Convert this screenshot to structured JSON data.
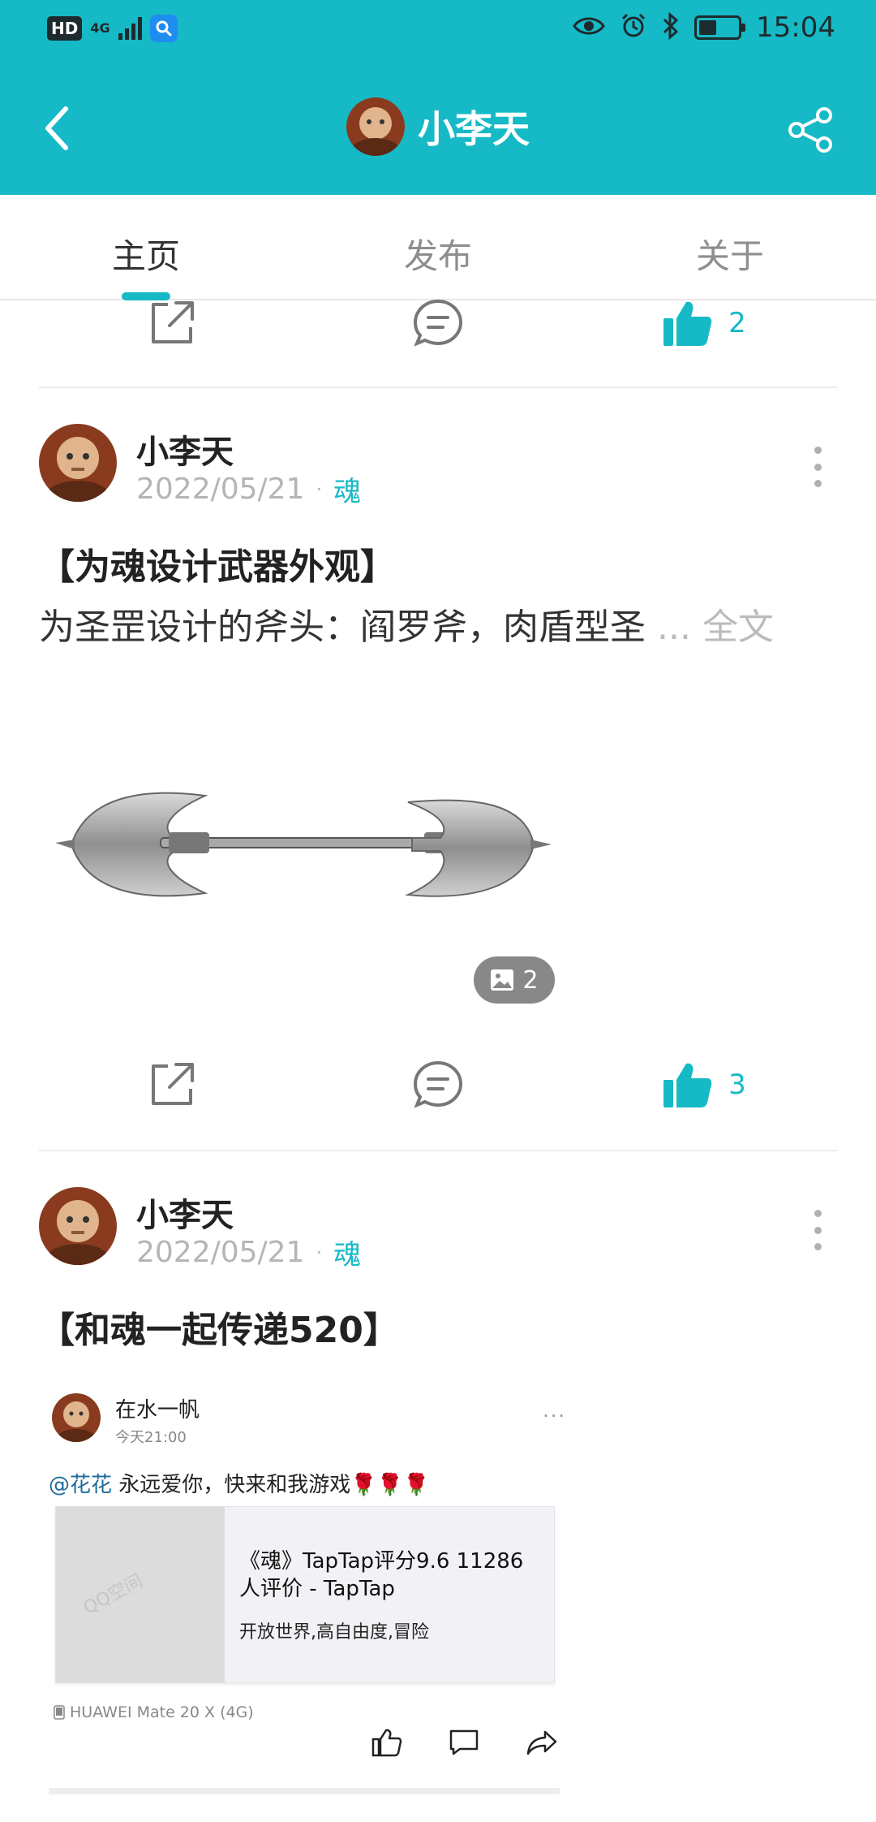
{
  "status_bar": {
    "hd": "HD",
    "network": "4G",
    "time": "15:04",
    "battery_level": 0.45
  },
  "header": {
    "title": "小李天",
    "accent_color": "#16b9c6"
  },
  "tabs": [
    {
      "label": "主页",
      "active": true
    },
    {
      "label": "发布",
      "active": false
    },
    {
      "label": "关于",
      "active": false
    }
  ],
  "top_actions": {
    "like_count": "2"
  },
  "posts": [
    {
      "author": "小李天",
      "date": "2022/05/21",
      "separator": "·",
      "tag": "魂",
      "title": "【为魂设计武器外观】",
      "excerpt": "为圣罡设计的斧头：阎罗斧，肉盾型圣",
      "ellipsis": " ... ",
      "more_label": "全文",
      "image_count": "2",
      "like_count": "3"
    },
    {
      "author": "小李天",
      "date": "2022/05/21",
      "separator": "·",
      "tag": "魂",
      "title": "【和魂一起传递520】",
      "embed": {
        "name": "在水一帆",
        "time": "今天21:00",
        "dots": "···",
        "mention": "@花花",
        "text": " 永远爱你，快来和我游戏",
        "flowers": "🌹🌹🌹",
        "card_title": "《魂》TapTap评分9.6 11286人评价 - TapTap",
        "card_subtitle": "开放世界,高自由度,冒险",
        "watermark": "QQ空间",
        "device": "HUAWEI Mate 20 X (4G)"
      }
    }
  ]
}
